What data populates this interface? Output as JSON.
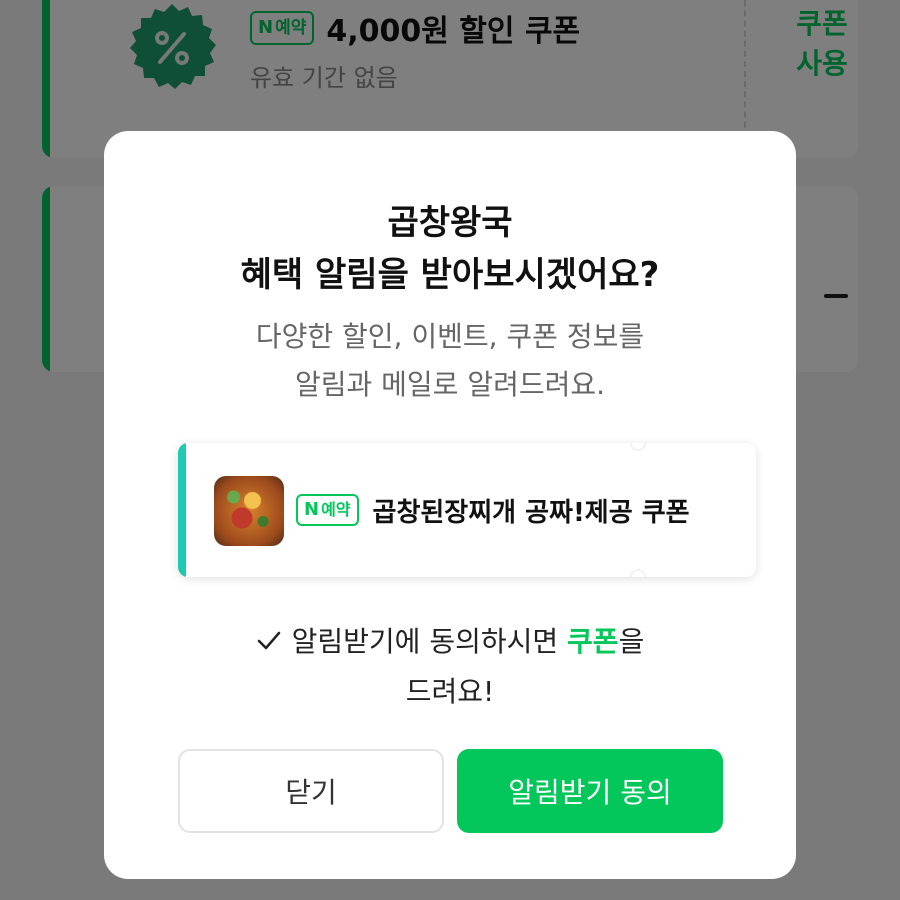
{
  "background": {
    "coupon_card": {
      "badge_n": "N",
      "badge_text": "예약",
      "title": "4,000원 할인 쿠폰",
      "validity": "유효 기간 없음",
      "use_coupon_line1": "쿠폰",
      "use_coupon_line2": "사용"
    }
  },
  "modal": {
    "title_line1": "곱창왕국",
    "title_line2": "혜택 알림을 받아보시겠어요?",
    "description_line1": "다양한 할인, 이벤트, 쿠폰 정보를",
    "description_line2": "알림과 메일로 알려드려요.",
    "ticket": {
      "badge_n": "N",
      "badge_text": "예약",
      "title": "곱창된장찌개 공짜!제공 쿠폰"
    },
    "consent": {
      "before": "알림받기에 동의하시면 ",
      "highlight": "쿠폰",
      "after": "을",
      "line2": "드려요!"
    },
    "buttons": {
      "close": "닫기",
      "agree": "알림받기 동의"
    }
  },
  "colors": {
    "accent_green": "#03c75a",
    "ticket_accent": "#1fcbb0",
    "overlay": "rgba(0,0,0,0.5)"
  },
  "icons": {
    "percent_badge": "percent-badge-icon",
    "check": "check-icon"
  }
}
